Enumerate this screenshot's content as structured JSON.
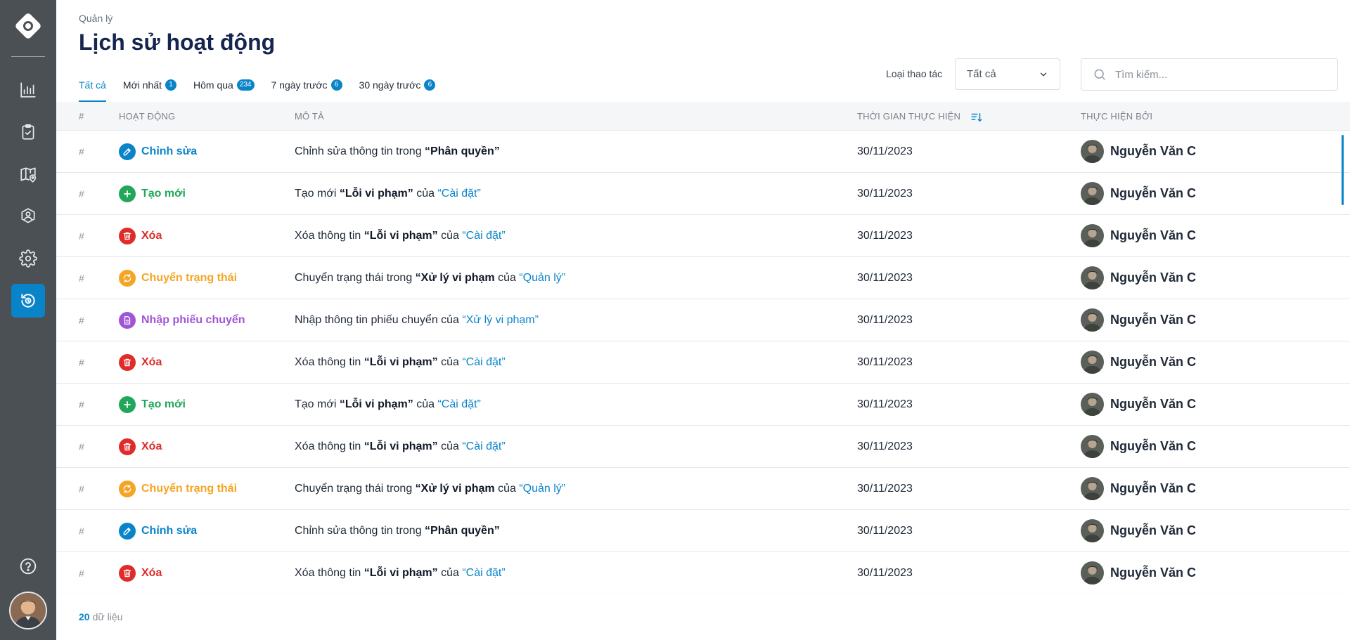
{
  "colors": {
    "sidebar": "#4b5055",
    "accent": "#0a84c8",
    "edit": "#0a84c8",
    "create": "#22a65a",
    "delete": "#e02b2b",
    "status": "#f5a524",
    "import": "#a055d6"
  },
  "sidebar": {
    "items": [
      {
        "name": "sidebar-item-statistics",
        "icon": "bar-chart-icon"
      },
      {
        "name": "sidebar-item-tasks",
        "icon": "clipboard-check-icon"
      },
      {
        "name": "sidebar-item-map",
        "icon": "map-pin-icon"
      },
      {
        "name": "sidebar-item-users",
        "icon": "user-group-icon"
      },
      {
        "name": "sidebar-item-settings",
        "icon": "gear-icon"
      },
      {
        "name": "sidebar-item-history",
        "icon": "history-icon"
      }
    ]
  },
  "header": {
    "breadcrumb": "Quản lý",
    "title": "Lịch sử hoạt động"
  },
  "tabs": [
    {
      "label": "Tất cả",
      "badge": ""
    },
    {
      "label": "Mới nhất",
      "badge": "1"
    },
    {
      "label": "Hôm qua",
      "badge": "234"
    },
    {
      "label": "7 ngày trước",
      "badge": "6"
    },
    {
      "label": "30 ngày trước",
      "badge": "6"
    }
  ],
  "filter": {
    "label": "Loại thao tác",
    "selected": "Tất cả"
  },
  "search": {
    "placeholder": "Tìm kiếm..."
  },
  "table": {
    "columns": {
      "hash": "#",
      "activity": "HOẠT ĐỘNG",
      "description": "MÔ TẢ",
      "time": "THỜI GIAN THỰC HIỆN",
      "user": "THỰC HIỆN BỞI"
    },
    "rows": [
      {
        "hash": "#",
        "type": "edit",
        "activity": "Chỉnh sửa",
        "desc_text": "Chỉnh sửa thông tin trong ",
        "desc_bold": "“Phân quyền”",
        "desc_of": "",
        "desc_link": "",
        "time": "30/11/2023",
        "user": "Nguyễn Văn C"
      },
      {
        "hash": "#",
        "type": "create",
        "activity": "Tạo mới",
        "desc_text": "Tạo mới ",
        "desc_bold": "“Lỗi vi phạm”",
        "desc_of": " của ",
        "desc_link": "“Cài đặt”",
        "time": "30/11/2023",
        "user": "Nguyễn Văn C"
      },
      {
        "hash": "#",
        "type": "delete",
        "activity": "Xóa",
        "desc_text": "Xóa thông tin ",
        "desc_bold": "“Lỗi vi phạm”",
        "desc_of": " của ",
        "desc_link": "“Cài đặt”",
        "time": "30/11/2023",
        "user": "Nguyễn Văn C"
      },
      {
        "hash": "#",
        "type": "status",
        "activity": "Chuyển trạng thái",
        "desc_text": "Chuyển trạng thái trong ",
        "desc_bold": "“Xử lý vi phạm",
        "desc_of": " của ",
        "desc_link": "“Quản lý”",
        "time": "30/11/2023",
        "user": "Nguyễn Văn C"
      },
      {
        "hash": "#",
        "type": "import",
        "activity": "Nhập phiếu chuyển",
        "desc_text": "Nhập thông tin phiếu chuyển của ",
        "desc_bold": "",
        "desc_of": "",
        "desc_link": "“Xử lý vi phạm”",
        "time": "30/11/2023",
        "user": "Nguyễn Văn C"
      },
      {
        "hash": "#",
        "type": "delete",
        "activity": "Xóa",
        "desc_text": "Xóa thông tin ",
        "desc_bold": "“Lỗi vi phạm”",
        "desc_of": " của ",
        "desc_link": "“Cài đặt”",
        "time": "30/11/2023",
        "user": "Nguyễn Văn C"
      },
      {
        "hash": "#",
        "type": "create",
        "activity": "Tạo mới",
        "desc_text": "Tạo mới ",
        "desc_bold": "“Lỗi vi phạm”",
        "desc_of": " của ",
        "desc_link": "“Cài đặt”",
        "time": "30/11/2023",
        "user": "Nguyễn Văn C"
      },
      {
        "hash": "#",
        "type": "delete",
        "activity": "Xóa",
        "desc_text": "Xóa thông tin ",
        "desc_bold": "“Lỗi vi phạm”",
        "desc_of": " của ",
        "desc_link": "“Cài đặt”",
        "time": "30/11/2023",
        "user": "Nguyễn Văn C"
      },
      {
        "hash": "#",
        "type": "status",
        "activity": "Chuyển trạng thái",
        "desc_text": "Chuyển trạng thái trong ",
        "desc_bold": "“Xử lý vi phạm",
        "desc_of": " của ",
        "desc_link": "“Quản lý”",
        "time": "30/11/2023",
        "user": "Nguyễn Văn C"
      },
      {
        "hash": "#",
        "type": "edit",
        "activity": "Chỉnh sửa",
        "desc_text": "Chỉnh sửa thông tin trong ",
        "desc_bold": "“Phân quyền”",
        "desc_of": "",
        "desc_link": "",
        "time": "30/11/2023",
        "user": "Nguyễn Văn C"
      },
      {
        "hash": "#",
        "type": "delete",
        "activity": "Xóa",
        "desc_text": "Xóa thông tin ",
        "desc_bold": "“Lỗi vi phạm”",
        "desc_of": " của ",
        "desc_link": "“Cài đặt”",
        "time": "30/11/2023",
        "user": "Nguyễn Văn C"
      }
    ]
  },
  "footer": {
    "count": "20",
    "label": "dữ liệu"
  }
}
